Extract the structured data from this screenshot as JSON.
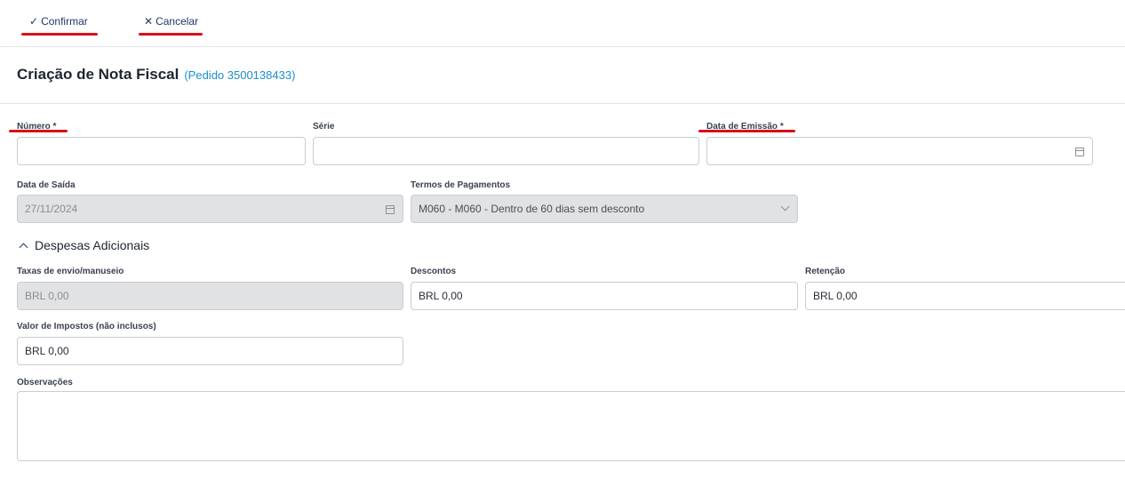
{
  "toolbar": {
    "confirm_label": "Confirmar",
    "cancel_label": "Cancelar"
  },
  "header": {
    "title": "Criação de Nota Fiscal",
    "subtitle": "(Pedido 3500138433)"
  },
  "form": {
    "numero": {
      "label": "Número *",
      "value": ""
    },
    "serie": {
      "label": "Série",
      "value": ""
    },
    "data_emissao": {
      "label": "Data de Emissão *",
      "value": ""
    },
    "data_saida": {
      "label": "Data de Saída",
      "value": "27/11/2024"
    },
    "termos": {
      "label": "Termos de Pagamentos",
      "value": "M060 - M060 - Dentro de 60 dias sem desconto"
    },
    "section_title": "Despesas Adicionais",
    "taxas": {
      "label": "Taxas de envio/manuseio",
      "value": "BRL 0,00"
    },
    "descontos": {
      "label": "Descontos",
      "value": "BRL 0,00"
    },
    "retencao": {
      "label": "Retenção",
      "value": "BRL 0,00"
    },
    "impostos": {
      "label": "Valor de Impostos (não inclusos)",
      "value": "BRL 0,00"
    },
    "observacoes": {
      "label": "Observações",
      "value": ""
    }
  },
  "icons": {
    "confirm": "check-icon",
    "cancel": "close-icon",
    "date": "calendar-icon",
    "dropdown": "chevron-down-icon",
    "section": "chevron-up-icon"
  },
  "colors": {
    "highlight_underline": "#d8101a",
    "link": "#1a8fc9",
    "toolbar_text": "#1d3a66"
  }
}
